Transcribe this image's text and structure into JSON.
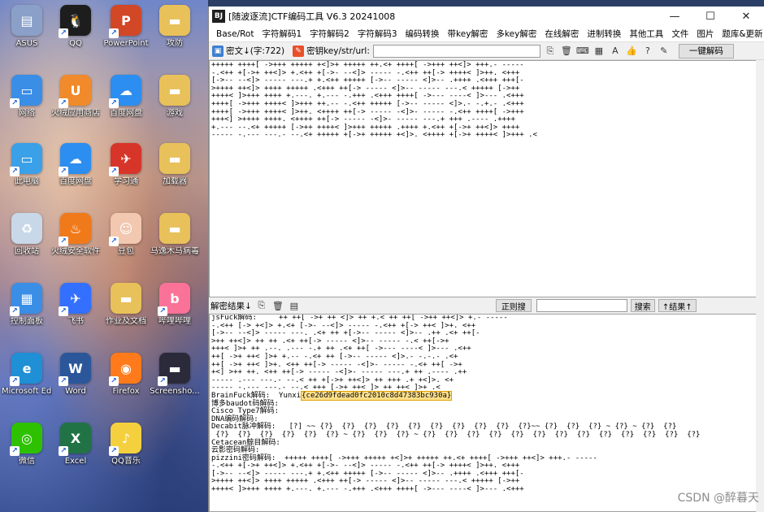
{
  "desktop": {
    "icons": [
      {
        "label": "ASUS",
        "icon": "folder-icon",
        "color": "#8aa0c8",
        "glyph": "▤"
      },
      {
        "label": "QQ",
        "icon": "qq-icon",
        "color": "#1d1d1d",
        "glyph": "🐧"
      },
      {
        "label": "PowerPoint",
        "icon": "powerpoint-icon",
        "color": "#d24726",
        "glyph": "P"
      },
      {
        "label": "攻防",
        "icon": "folder-icon",
        "color": "#e8c15a",
        "glyph": "▬"
      },
      {
        "label": "网络",
        "icon": "network-icon",
        "color": "#3a8ee6",
        "glyph": "▭"
      },
      {
        "label": "火绒应用商店",
        "icon": "store-icon",
        "color": "#f08a2a",
        "glyph": "U"
      },
      {
        "label": "百度网盘",
        "icon": "cloud-icon",
        "color": "#2b8ef0",
        "glyph": "☁"
      },
      {
        "label": "游戏",
        "icon": "folder-icon",
        "color": "#e8c15a",
        "glyph": "▬"
      },
      {
        "label": "此电脑",
        "icon": "computer-icon",
        "color": "#3aa0e8",
        "glyph": "▭"
      },
      {
        "label": "百度网盘",
        "icon": "cloud-icon",
        "color": "#2b8ef0",
        "glyph": "☁"
      },
      {
        "label": "学习通",
        "icon": "study-icon",
        "color": "#d8352a",
        "glyph": "✈"
      },
      {
        "label": "加载器",
        "icon": "folder-icon",
        "color": "#e8c15a",
        "glyph": "▬"
      },
      {
        "label": "回收站",
        "icon": "recycle-bin-icon",
        "color": "#c8d8e8",
        "glyph": "♻"
      },
      {
        "label": "火绒安全软件",
        "icon": "huorong-icon",
        "color": "#f07a1a",
        "glyph": "♨"
      },
      {
        "label": "豆包",
        "icon": "doubao-icon",
        "color": "#f2c8b0",
        "glyph": "☺"
      },
      {
        "label": "马逸木马病毒",
        "icon": "folder-icon",
        "color": "#e8c15a",
        "glyph": "▬"
      },
      {
        "label": "控制面板",
        "icon": "control-panel-icon",
        "color": "#3a8ee6",
        "glyph": "▦"
      },
      {
        "label": "飞书",
        "icon": "feishu-icon",
        "color": "#3370ff",
        "glyph": "✈"
      },
      {
        "label": "作业及文档",
        "icon": "folder-icon",
        "color": "#e8c15a",
        "glyph": "▬"
      },
      {
        "label": "哔哩哔哩",
        "icon": "bilibili-icon",
        "color": "#fb7299",
        "glyph": "b"
      },
      {
        "label": "Microsoft Edge",
        "icon": "edge-icon",
        "color": "#1f8fd6",
        "glyph": "e"
      },
      {
        "label": "Word",
        "icon": "word-icon",
        "color": "#2b579a",
        "glyph": "W"
      },
      {
        "label": "Firefox",
        "icon": "firefox-icon",
        "color": "#ff7a1a",
        "glyph": "◉"
      },
      {
        "label": "Screensho...",
        "icon": "screenshot-icon",
        "color": "#2a2a3a",
        "glyph": "▬"
      },
      {
        "label": "微信",
        "icon": "wechat-icon",
        "color": "#2dc100",
        "glyph": "◎"
      },
      {
        "label": "Excel",
        "icon": "excel-icon",
        "color": "#217346",
        "glyph": "X"
      },
      {
        "label": "QQ音乐",
        "icon": "qqmusic-icon",
        "color": "#f4d03f",
        "glyph": "♪"
      }
    ]
  },
  "window": {
    "title": "[随波逐流]CTF编码工具 V6.3 20241008",
    "menu": [
      "Base/Rot",
      "字符解码1",
      "字符解码2",
      "字符解码3",
      "编码转换",
      "带key解密",
      "多key解密",
      "在线解密",
      "进制转换",
      "其他工具",
      "文件",
      "图片",
      "题库&更新"
    ],
    "text_label": "密文↓(字:722)",
    "key_label": "密钥key/str/url:",
    "key_value": "",
    "one_key_decode": "一键解码",
    "result_label": "解密结果↓",
    "regex_search": "正则搜",
    "search_value": "",
    "search_button": "搜索",
    "result_toggle": "↑结果↑"
  },
  "ciphertext_lines": [
    "+++++ ++++[ ->+++ +++++ +<]>+ +++++ ++.<+ ++++[ ->+++ ++<]> +++.- -----",
    "-.<++ +[->+ ++<]> +.<++ +[->- --<]> ----- -.<++ ++[-> ++++< ]>++. <+++",
    "[->-- --<]> ----- ---.+ +.<++ +++++ [->-- ----- <]>-- .++++ .<+++ +++[-",
    ">++++ ++<]> ++++ +++++ .<+++ ++[-> ----- <]>-- ----- ---.< +++++ [->++",
    "++++< ]>+++ ++++ +.---. +.--- -.+++ .<+++ ++++[ ->--- ----< ]>--- .<+++",
    "++++[ ->+++ ++++< ]>+++ ++.-- -.<++ +++++ [->-- ----- <]>.- -.+.- .<+++",
    "++++[ ->+++ ++++< ]>++. <++++ ++[-> ----- -<]>- ----- -.<++ ++++[ ->+++",
    "+++<] >++++ ++++. <++++ ++[-> ----- -<]>- ----- ---.+ +++ .---- .++++",
    "+.--- --.<+ +++++ [->++ ++++< ]>+++ +++++ .++++ +.<++ +[->+ ++<]> ++++",
    "----- -.--- ---.- --.<+ +++++ +[->+ +++++ +<]>. <++++ +[->+ ++++< ]>+++ .<"
  ],
  "output_lines": [
    "jsFuck解码:     ++ ++[ ->+ ++ <]> ++ +.< ++ ++[ ->++ ++<]> +.- -----",
    "-.<++ [-> +<]> +.<+ [->- --<]> ----- -.<++ +[-> ++< ]>+. <++",
    "[->-- --<]> ----- ---. .<+ ++ +[->-- ----- <]>-- .++ .<+ ++[-",
    ">++ ++<]> ++ ++ .<+ ++[-> ----- <]>-- ----- -.< ++[->+",
    "+++< ]>+ ++ .--. .--- -.+ ++ .<+ ++[ ->--- ----< ]>--- .<++",
    "++[ ->+ ++< ]>+ +.-- -.<+ ++ [->-- ----- <]>.- -.-.- .<+",
    "++[ ->+ ++< ]>+. <++ ++[-> ----- -<]>- ----- -.<+ ++[ ->+",
    "+<] >++ ++. <++ ++[-> ----- -<]>- ----- ---.+ ++ .---- .++",
    "----- .--- ---.- --.< ++ +[->+ ++<]> ++ +++ .+ +<]>. <+",
    "----- -.--- ---.- --.< +++ [->+ ++< ]> ++ ++< ]>+ .<"
  ],
  "brainfuck_label": "BrainFuck解码:",
  "brainfuck_prefix": "Yunxi",
  "brainfuck_flag": "{ce26d9fdead0fc2010c8d47383bc930a}",
  "more_lines": [
    "博多baudot码解码:",
    "Cisco Type7解码:",
    "DNA编码解码:",
    "Decabit脉冲解码:   [?] ~~ {?}  {?}  {?}  {?}  {?}  {?}  {?}  {?}  {?}  {?}~~ {?}  {?}  {?} ~ {?} ~ {?}  {?}",
    " {?}  {?}  {?}  {?}  {?}  {?} ~ {?}  {?}  {?} ~ {?}  {?}  {?}  {?}  {?}  {?}  {?}  {?}  {?}  {?}  {?}  {?}  {?}",
    "Cetacean鲸目解码:",
    "云影密码解码:",
    "pizzini密码解码:  +++++ ++++[ ->+++ +++++ +<]>+ +++++ ++.<+ ++++[ ->+++ ++<]> +++.- -----",
    "-.<++ +[->+ ++<]> +.<++ +[->- --<]> ----- -.<++ ++[-> ++++< ]>++. <+++",
    "[->-- --<]> ----- ---.+ +.<++ +++++ [->-- ----- <]>-- .++++ .<+++ +++[-",
    ">++++ ++<]> ++++ +++++ .<+++ ++[-> ----- <]>-- ----- ---.< +++++ [->++",
    "++++< ]>+++ ++++ +.---. +.--- -.+++ .<+++ ++++[ ->--- ----< ]>--- .<+++"
  ],
  "watermark": "CSDN @醉暮天"
}
